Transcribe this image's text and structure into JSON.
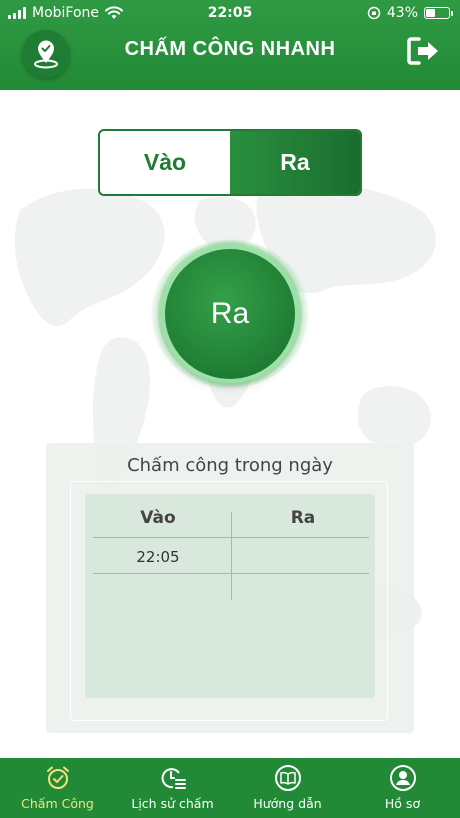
{
  "status_bar": {
    "carrier": "MobiFone",
    "time": "22:05",
    "battery_percent": "43%",
    "battery_level": 0.43
  },
  "header": {
    "title": "CHẤM CÔNG NHANH"
  },
  "mode_toggle": {
    "options": [
      {
        "label": "Vào",
        "selected": false
      },
      {
        "label": "Ra",
        "selected": true
      }
    ]
  },
  "action_button": {
    "label": "Ra"
  },
  "day_panel": {
    "title": "Chấm công trong ngày",
    "columns": [
      "Vào",
      "Ra"
    ],
    "rows": [
      {
        "vao": "22:05",
        "ra": ""
      }
    ]
  },
  "bottom_nav": {
    "items": [
      {
        "label": "Chấm Công",
        "icon": "alarm-clock-icon",
        "active": true
      },
      {
        "label": "Lịch sử chấm",
        "icon": "history-list-icon",
        "active": false
      },
      {
        "label": "Hướng dẫn",
        "icon": "book-icon",
        "active": false
      },
      {
        "label": "Hồ sơ",
        "icon": "profile-icon",
        "active": false
      }
    ]
  },
  "colors": {
    "primary": "#228a37",
    "primary_dark": "#1f7d33",
    "active_nav": "#f3e27a",
    "panel_bg": "#ecf1ee",
    "table_bg": "#d8e8dd"
  }
}
